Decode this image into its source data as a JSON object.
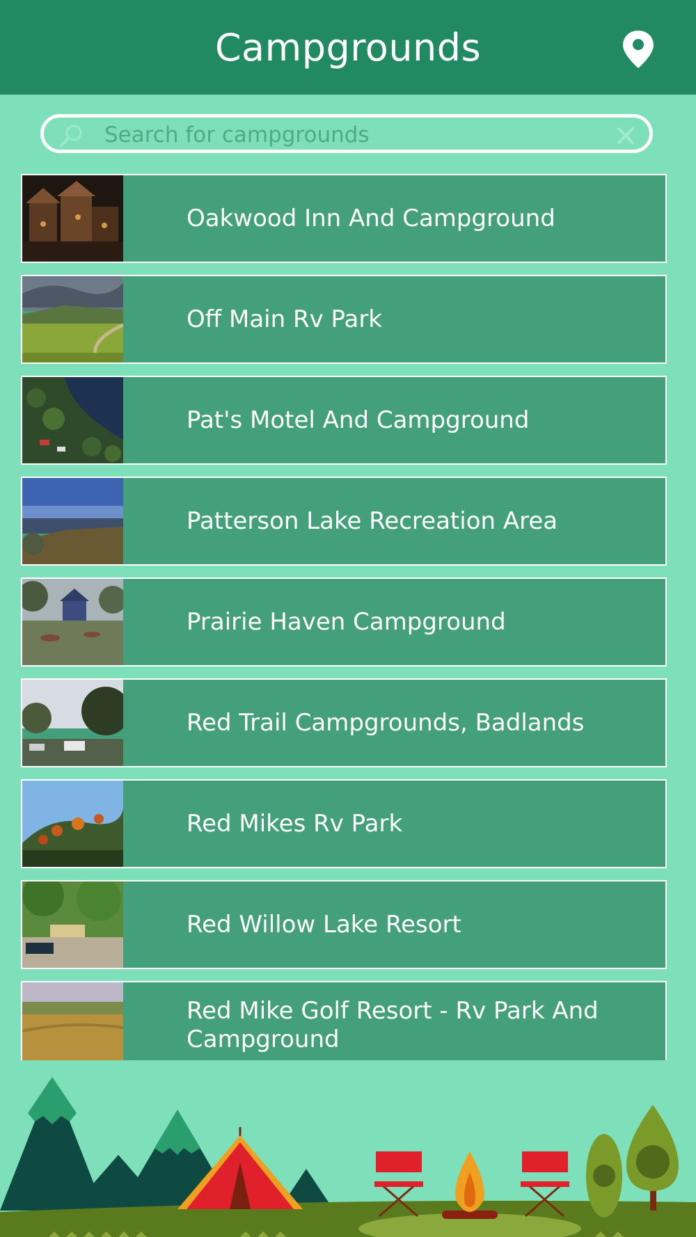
{
  "header": {
    "title": "Campgrounds",
    "map_icon": "map-pin-icon"
  },
  "search": {
    "placeholder": "Search for campgrounds",
    "value": "",
    "search_icon": "magnifier-icon",
    "clear_icon": "close-icon"
  },
  "campgrounds": [
    {
      "name": "Oakwood Inn And Campground"
    },
    {
      "name": "Off Main Rv Park"
    },
    {
      "name": "Pat's Motel And Campground"
    },
    {
      "name": "Patterson Lake Recreation Area"
    },
    {
      "name": "Prairie Haven Campground"
    },
    {
      "name": "Red Trail Campgrounds, Badlands"
    },
    {
      "name": "Red Mikes Rv Park"
    },
    {
      "name": "Red Willow Lake Resort"
    },
    {
      "name": "Red Mike Golf Resort - Rv Park And Campground"
    }
  ],
  "colors": {
    "header": "#228a62",
    "background": "#7de0bb",
    "row": "#43a07b",
    "text": "#ffffff"
  }
}
